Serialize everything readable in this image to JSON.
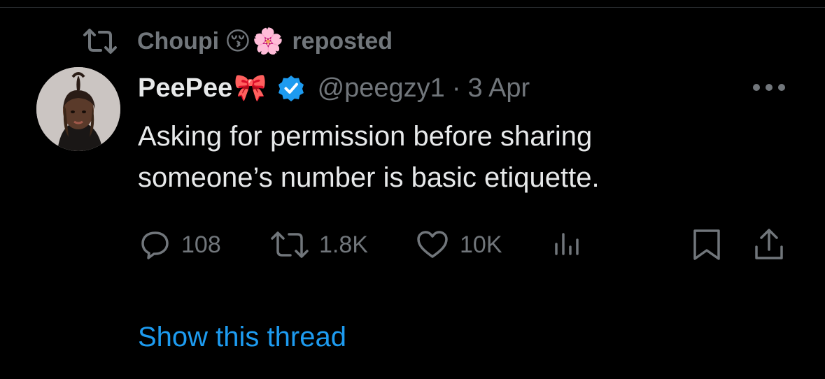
{
  "repost_banner": {
    "user_name": "Choupi",
    "emoji_1": "😚",
    "emoji_2": "🌸",
    "label": "reposted",
    "icon": "repost-icon"
  },
  "tweet": {
    "author": {
      "display_name": "PeePee",
      "name_emoji": "🎀",
      "handle": "@peegzy1",
      "separator": "·",
      "date": "3 Apr",
      "verified": true,
      "verified_icon": "verified-badge-icon",
      "verified_color": "#1d9bf0"
    },
    "text_lines": [
      "Asking for permission before sharing",
      "someone’s number is basic etiquette."
    ],
    "actions": {
      "replies": "108",
      "reposts": "1.8K",
      "likes": "10K"
    },
    "show_thread": "Show this thread"
  },
  "colors": {
    "background": "#000000",
    "primary_text": "#e7e9ea",
    "secondary_text": "#71767b",
    "link": "#1d9bf0"
  }
}
